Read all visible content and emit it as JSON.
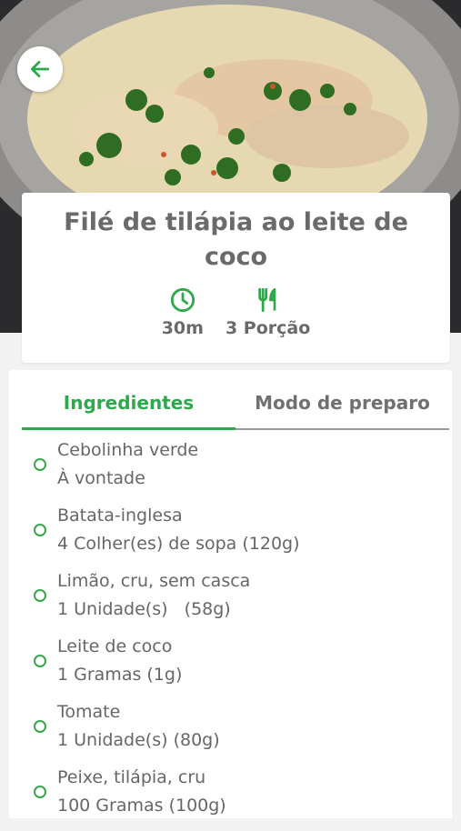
{
  "recipe": {
    "title": "Filé de tilápia ao leite de coco",
    "time": "30m",
    "portions": "3 Porção"
  },
  "icons": {
    "back": "arrow-left-icon",
    "time": "clock-icon",
    "portions": "fork-knife-icon"
  },
  "tabs": [
    {
      "label": "Ingredientes",
      "active": true
    },
    {
      "label": "Modo de preparo",
      "active": false
    }
  ],
  "ingredients": [
    {
      "name": "Cebolinha verde",
      "qty": "À vontade"
    },
    {
      "name": "Batata-inglesa",
      "qty": "4 Colher(es) de sopa (120g)"
    },
    {
      "name": "Limão, cru, sem casca",
      "qty": "1 Unidade(s)   (58g)"
    },
    {
      "name": "Leite de coco",
      "qty": "1 Gramas (1g)"
    },
    {
      "name": "Tomate",
      "qty": "1 Unidade(s) (80g)"
    },
    {
      "name": "Peixe, tilápia, cru",
      "qty": "100 Gramas (100g)"
    }
  ],
  "colors": {
    "accent": "#2ea84a",
    "text": "#666666"
  }
}
